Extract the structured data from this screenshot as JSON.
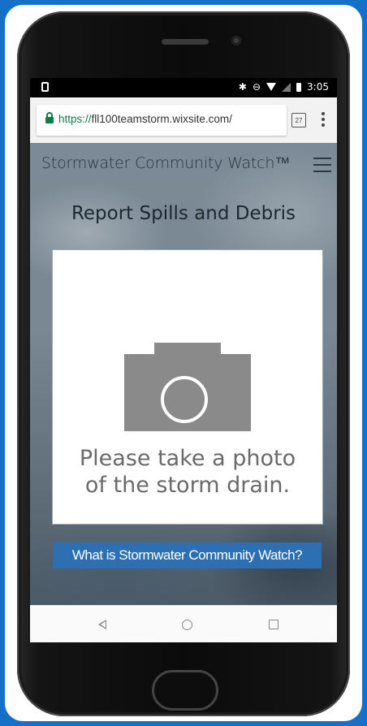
{
  "status_bar": {
    "time": "3:05"
  },
  "browser": {
    "url_scheme": "https://",
    "url_host": "fll100teamstorm.wixsite.com/",
    "tab_count": "27"
  },
  "site": {
    "title": "Stormwater Community Watch™"
  },
  "main": {
    "heading": "Report Spills and Debris",
    "upload_prompt_line1": "Please take a photo",
    "upload_prompt_line2": "of the storm drain.",
    "info_link_label": "What is Stormwater Community Watch?"
  },
  "colors": {
    "frame_background": "#1670c8",
    "info_link_background": "#2d6fb3",
    "camera_gray": "#8a8a8a",
    "lock_green": "#0b8043"
  },
  "icons": [
    "device-icon",
    "bluetooth-icon",
    "do-not-disturb-icon",
    "wifi-icon",
    "signal-icon",
    "battery-icon",
    "lock-icon",
    "tabs-icon",
    "overflow-menu-icon",
    "hamburger-menu-icon",
    "camera-icon",
    "back-icon",
    "home-icon",
    "recents-icon"
  ]
}
